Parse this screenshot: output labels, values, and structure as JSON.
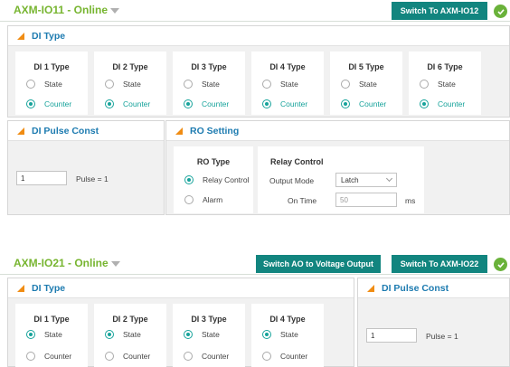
{
  "module1": {
    "title": "AXM-IO11 - Online",
    "switch_btn": "Switch To AXM-IO12",
    "di_type": {
      "title": "DI Type",
      "cards": [
        {
          "label": "DI 1 Type",
          "opt1": "State",
          "opt2": "Counter",
          "selected": "Counter"
        },
        {
          "label": "DI 2 Type",
          "opt1": "State",
          "opt2": "Counter",
          "selected": "Counter"
        },
        {
          "label": "DI 3 Type",
          "opt1": "State",
          "opt2": "Counter",
          "selected": "Counter"
        },
        {
          "label": "DI 4 Type",
          "opt1": "State",
          "opt2": "Counter",
          "selected": "Counter"
        },
        {
          "label": "DI 5 Type",
          "opt1": "State",
          "opt2": "Counter",
          "selected": "Counter"
        },
        {
          "label": "DI 6 Type",
          "opt1": "State",
          "opt2": "Counter",
          "selected": "Counter"
        }
      ]
    },
    "pulse": {
      "title": "DI Pulse Const",
      "value": "1",
      "unit_label": "Pulse = 1"
    },
    "ro": {
      "title": "RO Setting",
      "ro_type": {
        "label": "RO Type",
        "opt1": "Relay Control",
        "opt2": "Alarm",
        "selected": "Relay Control"
      },
      "relay": {
        "label": "Relay Control",
        "mode_label": "Output Mode",
        "mode_value": "Latch",
        "ontime_label": "On Time",
        "ontime_value": "50",
        "ontime_unit": "ms"
      }
    }
  },
  "module2": {
    "title": "AXM-IO21 - Online",
    "ao_btn": "Switch AO to Voltage Output",
    "switch_btn": "Switch To AXM-IO22",
    "di_type": {
      "title": "DI Type",
      "cards": [
        {
          "label": "DI 1 Type",
          "opt1": "State",
          "opt2": "Counter",
          "selected": "State"
        },
        {
          "label": "DI 2 Type",
          "opt1": "State",
          "opt2": "Counter",
          "selected": "State"
        },
        {
          "label": "DI 3 Type",
          "opt1": "State",
          "opt2": "Counter",
          "selected": "State"
        },
        {
          "label": "DI 4 Type",
          "opt1": "State",
          "opt2": "Counter",
          "selected": "State"
        }
      ]
    },
    "pulse": {
      "title": "DI Pulse Const",
      "value": "1",
      "unit_label": "Pulse = 1"
    }
  },
  "colors": {
    "accent_green": "#77b530",
    "button_teal": "#12857f",
    "radio_teal": "#17a39b",
    "title_blue": "#1d7bb0",
    "triangle_orange": "#f08c13"
  }
}
